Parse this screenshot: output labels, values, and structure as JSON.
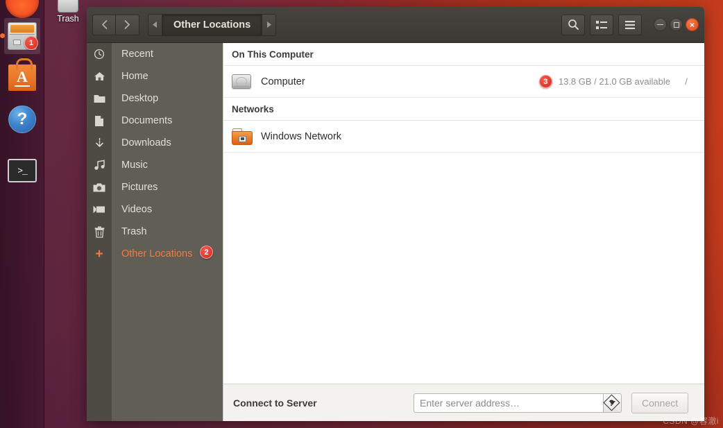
{
  "desktop": {
    "trash_label": "Trash",
    "trash_icon": "trash-can-icon",
    "watermark": "CSDN @容澈i"
  },
  "launcher": {
    "items": [
      {
        "name": "dash-home",
        "icon": "ubuntu-dash-icon",
        "badge": null,
        "active": false
      },
      {
        "name": "files",
        "icon": "files-cabinet-icon",
        "badge": "1",
        "active": true
      },
      {
        "name": "ubuntu-software",
        "icon": "software-bag-icon",
        "badge": null,
        "active": false
      },
      {
        "name": "help",
        "icon": "help-question-icon",
        "badge": null,
        "active": false
      },
      {
        "name": "terminal",
        "icon": "terminal-icon",
        "glyph": ">_",
        "badge": null,
        "active": false
      }
    ]
  },
  "window": {
    "header": {
      "back_icon": "chevron-left-icon",
      "forward_icon": "chevron-right-icon",
      "path_prev_icon": "triangle-left-icon",
      "path_next_icon": "triangle-right-icon",
      "breadcrumb": "Other Locations",
      "search_icon": "search-icon",
      "view_icon": "list-view-icon",
      "menu_icon": "hamburger-menu-icon",
      "minimize_icon": "minimize-icon",
      "maximize_icon": "maximize-icon",
      "close_icon": "close-icon"
    },
    "sidebar": {
      "items": [
        {
          "label": "Recent",
          "icon": "clock-icon",
          "badge": null,
          "selected": false
        },
        {
          "label": "Home",
          "icon": "home-icon",
          "badge": null,
          "selected": false
        },
        {
          "label": "Desktop",
          "icon": "folder-icon",
          "badge": null,
          "selected": false
        },
        {
          "label": "Documents",
          "icon": "document-icon",
          "badge": null,
          "selected": false
        },
        {
          "label": "Downloads",
          "icon": "download-icon",
          "badge": null,
          "selected": false
        },
        {
          "label": "Music",
          "icon": "music-note-icon",
          "badge": null,
          "selected": false
        },
        {
          "label": "Pictures",
          "icon": "camera-icon",
          "badge": null,
          "selected": false
        },
        {
          "label": "Videos",
          "icon": "video-camera-icon",
          "badge": null,
          "selected": false
        },
        {
          "label": "Trash",
          "icon": "trash-icon",
          "badge": null,
          "selected": false
        },
        {
          "label": "Other Locations",
          "icon": "plus-icon",
          "badge": "2",
          "selected": true
        }
      ]
    },
    "content": {
      "sections": [
        {
          "heading": "On This Computer",
          "rows": [
            {
              "name": "Computer",
              "icon": "hard-drive-icon",
              "badge": "3",
              "capacity": "13.8 GB / 21.0 GB available",
              "mount": "/"
            }
          ]
        },
        {
          "heading": "Networks",
          "rows": [
            {
              "name": "Windows Network",
              "icon": "network-folder-icon",
              "badge": null,
              "capacity": "",
              "mount": ""
            }
          ]
        }
      ]
    },
    "connect_bar": {
      "label": "Connect to Server",
      "input_value": "",
      "input_placeholder": "Enter server address…",
      "help_icon": "help-hint-icon",
      "dropdown_icon": "chevron-down-icon",
      "connect_label": "Connect",
      "connect_disabled": true
    }
  },
  "colors": {
    "accent_orange": "#ef7b47",
    "badge_red": "#d9281c",
    "sidebar_bg": "#615e55",
    "sidebar_icon_col": "#4e4b44",
    "header_bg": "#3f3c38",
    "close_button": "#df4c1e"
  }
}
